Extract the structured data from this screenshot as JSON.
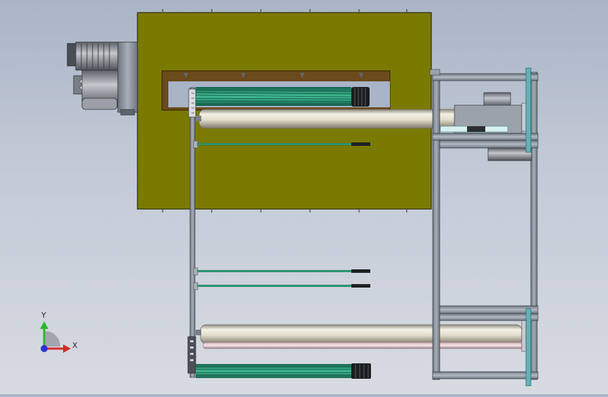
{
  "viewport": {
    "background_top": "#a9b4c6",
    "background_bottom": "#d7dbe2"
  },
  "model": {
    "plate_color": "#7b7a00",
    "frame_color": "#8a929e",
    "roller_color": "#e6e2d4",
    "green_rod_color": "#1f8a6a",
    "motor_color": "#8c9099",
    "glass_color": "#5fb3b8"
  },
  "triad": {
    "y_label": "Y",
    "x_label": "X",
    "y_color": "#2db52d",
    "x_color": "#d22a2a",
    "z_color": "#2a34d2"
  }
}
